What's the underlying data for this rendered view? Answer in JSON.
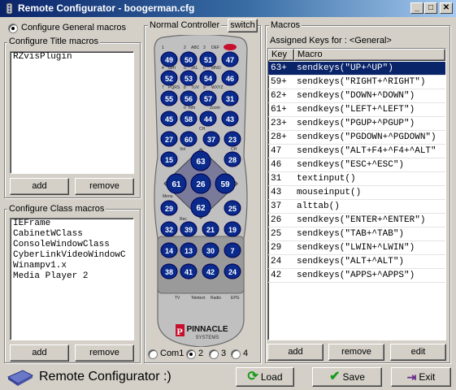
{
  "window": {
    "title": "Remote Configurator - boogerman.cfg",
    "btn_min": "_",
    "btn_max": "□",
    "btn_close": "✕"
  },
  "general_radio_label": "Configure General macros",
  "title_macros": {
    "label": "Configure Title macros",
    "items": [
      "RZvisPlugin"
    ],
    "add": "add",
    "remove": "remove"
  },
  "class_macros": {
    "label": "Configure Class macros",
    "items": [
      "IEFrame",
      "CabinetWClass",
      "ConsoleWindowClass",
      "CyberLinkVideoWindowC",
      "Winampv1.x",
      "Media Player 2"
    ],
    "add": "add",
    "remove": "remove"
  },
  "controller": {
    "label": "Normal Controller",
    "switch": "switch",
    "brand_top": "PINNACLE",
    "brand_bottom": "SYSTEMS",
    "com_ports": [
      "Com1",
      "2",
      "3",
      "4"
    ],
    "selected_port": "2"
  },
  "remote_buttons": [
    {
      "code": "49",
      "type": "dark"
    },
    {
      "code": "50",
      "type": "dark"
    },
    {
      "code": "51",
      "type": "dark"
    },
    {
      "code": "47",
      "type": "dark"
    },
    {
      "code": "52",
      "type": "dark"
    },
    {
      "code": "53",
      "type": "dark"
    },
    {
      "code": "54",
      "type": "dark"
    },
    {
      "code": "46",
      "type": "dark"
    },
    {
      "code": "55",
      "type": "dark"
    },
    {
      "code": "56",
      "type": "dark"
    },
    {
      "code": "57",
      "type": "dark"
    },
    {
      "code": "31",
      "type": "dark"
    },
    {
      "code": "45",
      "type": "dark"
    },
    {
      "code": "58",
      "type": "dark"
    },
    {
      "code": "44",
      "type": "dark"
    },
    {
      "code": "43",
      "type": "dark"
    },
    {
      "code": "27",
      "type": "dark"
    },
    {
      "code": "60",
      "type": "dark"
    },
    {
      "code": "37",
      "type": "dark"
    },
    {
      "code": "23",
      "type": "dark"
    },
    {
      "code": "15",
      "type": "dark"
    },
    {
      "code": "28",
      "type": "dark"
    },
    {
      "code": "63",
      "type": "dpad"
    },
    {
      "code": "61",
      "type": "dpad"
    },
    {
      "code": "26",
      "type": "dpad"
    },
    {
      "code": "59",
      "type": "dpad"
    },
    {
      "code": "62",
      "type": "dpad"
    },
    {
      "code": "29",
      "type": "dark"
    },
    {
      "code": "25",
      "type": "dark"
    },
    {
      "code": "32",
      "type": "dark"
    },
    {
      "code": "39",
      "type": "dark"
    },
    {
      "code": "21",
      "type": "dark"
    },
    {
      "code": "19",
      "type": "dark"
    },
    {
      "code": "14",
      "type": "blue"
    },
    {
      "code": "13",
      "type": "blue"
    },
    {
      "code": "30",
      "type": "blue"
    },
    {
      "code": "7",
      "type": "blue"
    },
    {
      "code": "38",
      "type": "blue"
    },
    {
      "code": "41",
      "type": "blue"
    },
    {
      "code": "42",
      "type": "blue"
    },
    {
      "code": "24",
      "type": "blue"
    }
  ],
  "remote_labels": [
    "1",
    "2",
    "ABC",
    "3",
    "DEF",
    "4",
    "GHI",
    "5",
    "JKL",
    "6",
    "MNO",
    "7",
    "PQRS",
    "8",
    "TUV",
    "9",
    "WXYZ",
    "0",
    "Info",
    "Zoom",
    "CH",
    "Vol",
    "CH",
    "Menu",
    "Rec",
    "TV",
    "Teletext",
    "Radio",
    "EPG"
  ],
  "macros": {
    "label": "Macros",
    "assigned": "Assigned Keys for : <General>",
    "col_key": "Key",
    "col_macro": "Macro",
    "rows": [
      {
        "key": "63+",
        "macro": "sendkeys(\"UP+^UP\")"
      },
      {
        "key": "59+",
        "macro": "sendkeys(\"RIGHT+^RIGHT\")"
      },
      {
        "key": "62+",
        "macro": "sendkeys(\"DOWN+^DOWN\")"
      },
      {
        "key": "61+",
        "macro": "sendkeys(\"LEFT+^LEFT\")"
      },
      {
        "key": "23+",
        "macro": "sendkeys(\"PGUP+^PGUP\")"
      },
      {
        "key": "28+",
        "macro": "sendkeys(\"PGDOWN+^PGDOWN\")"
      },
      {
        "key": "47",
        "macro": "sendkeys(\"ALT+F4+^F4+^ALT\""
      },
      {
        "key": "46",
        "macro": "sendkeys(\"ESC+^ESC\")"
      },
      {
        "key": "31",
        "macro": "textinput()"
      },
      {
        "key": "43",
        "macro": "mouseinput()"
      },
      {
        "key": "37",
        "macro": "alttab()"
      },
      {
        "key": "26",
        "macro": "sendkeys(\"ENTER+^ENTER\")"
      },
      {
        "key": "25",
        "macro": "sendkeys(\"TAB+^TAB\")"
      },
      {
        "key": "29",
        "macro": "sendkeys(\"LWIN+^LWIN\")"
      },
      {
        "key": "24",
        "macro": "sendkeys(\"ALT+^ALT\")"
      },
      {
        "key": "42",
        "macro": "sendkeys(\"APPS+^APPS\")"
      }
    ],
    "selected_index": 0,
    "add": "add",
    "remove": "remove",
    "edit": "edit"
  },
  "footer": {
    "app_name": "Remote Configurator :)",
    "load": "Load",
    "save": "Save",
    "exit": "Exit"
  },
  "colors": {
    "titlebar": "#0a246a",
    "selection": "#0a246a",
    "remote_button": "#0a2a8c",
    "remote_body": "#c0c0c0",
    "remote_power": "#c8102e"
  }
}
